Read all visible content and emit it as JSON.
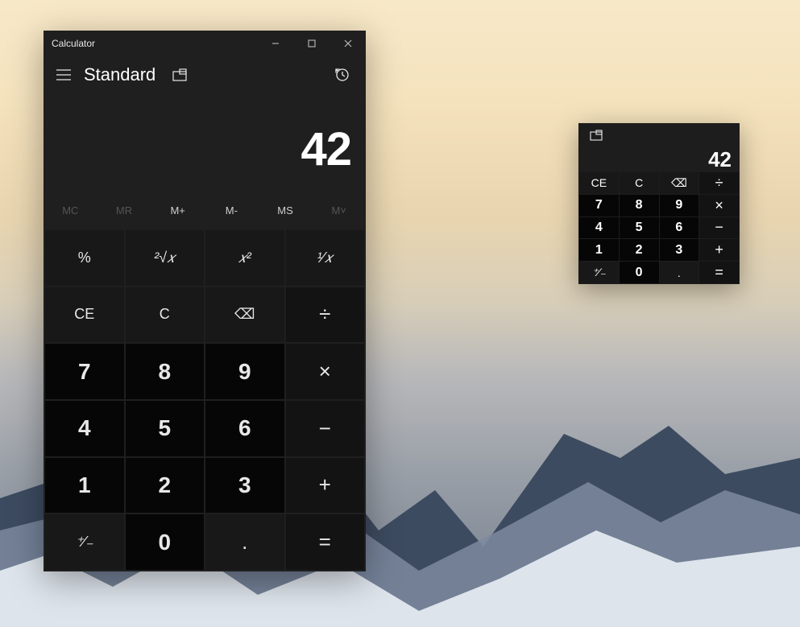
{
  "app_title": "Calculator",
  "mode_label": "Standard",
  "display_value": "42",
  "memory": {
    "mc": "MC",
    "mr": "MR",
    "mplus": "M+",
    "mminus": "M-",
    "ms": "MS",
    "mlist": "M˅"
  },
  "keys": {
    "percent": "%",
    "root": "²√𝑥",
    "sq": "𝑥²",
    "recip": "¹⁄𝑥",
    "ce": "CE",
    "c": "C",
    "back": "⌫",
    "div": "÷",
    "mul": "×",
    "sub": "−",
    "add": "+",
    "eq": "=",
    "neg": "⁺⁄₋",
    "dec": ".",
    "d0": "0",
    "d1": "1",
    "d2": "2",
    "d3": "3",
    "d4": "4",
    "d5": "5",
    "d6": "6",
    "d7": "7",
    "d8": "8",
    "d9": "9"
  },
  "mini": {
    "display_value": "42",
    "keys": {
      "ce": "CE",
      "c": "C",
      "back": "⌫",
      "div": "÷",
      "mul": "×",
      "sub": "−",
      "add": "+",
      "eq": "=",
      "neg": "⁺⁄₋",
      "dec": ".",
      "d0": "0",
      "d1": "1",
      "d2": "2",
      "d3": "3",
      "d4": "4",
      "d5": "5",
      "d6": "6",
      "d7": "7",
      "d8": "8",
      "d9": "9"
    }
  }
}
